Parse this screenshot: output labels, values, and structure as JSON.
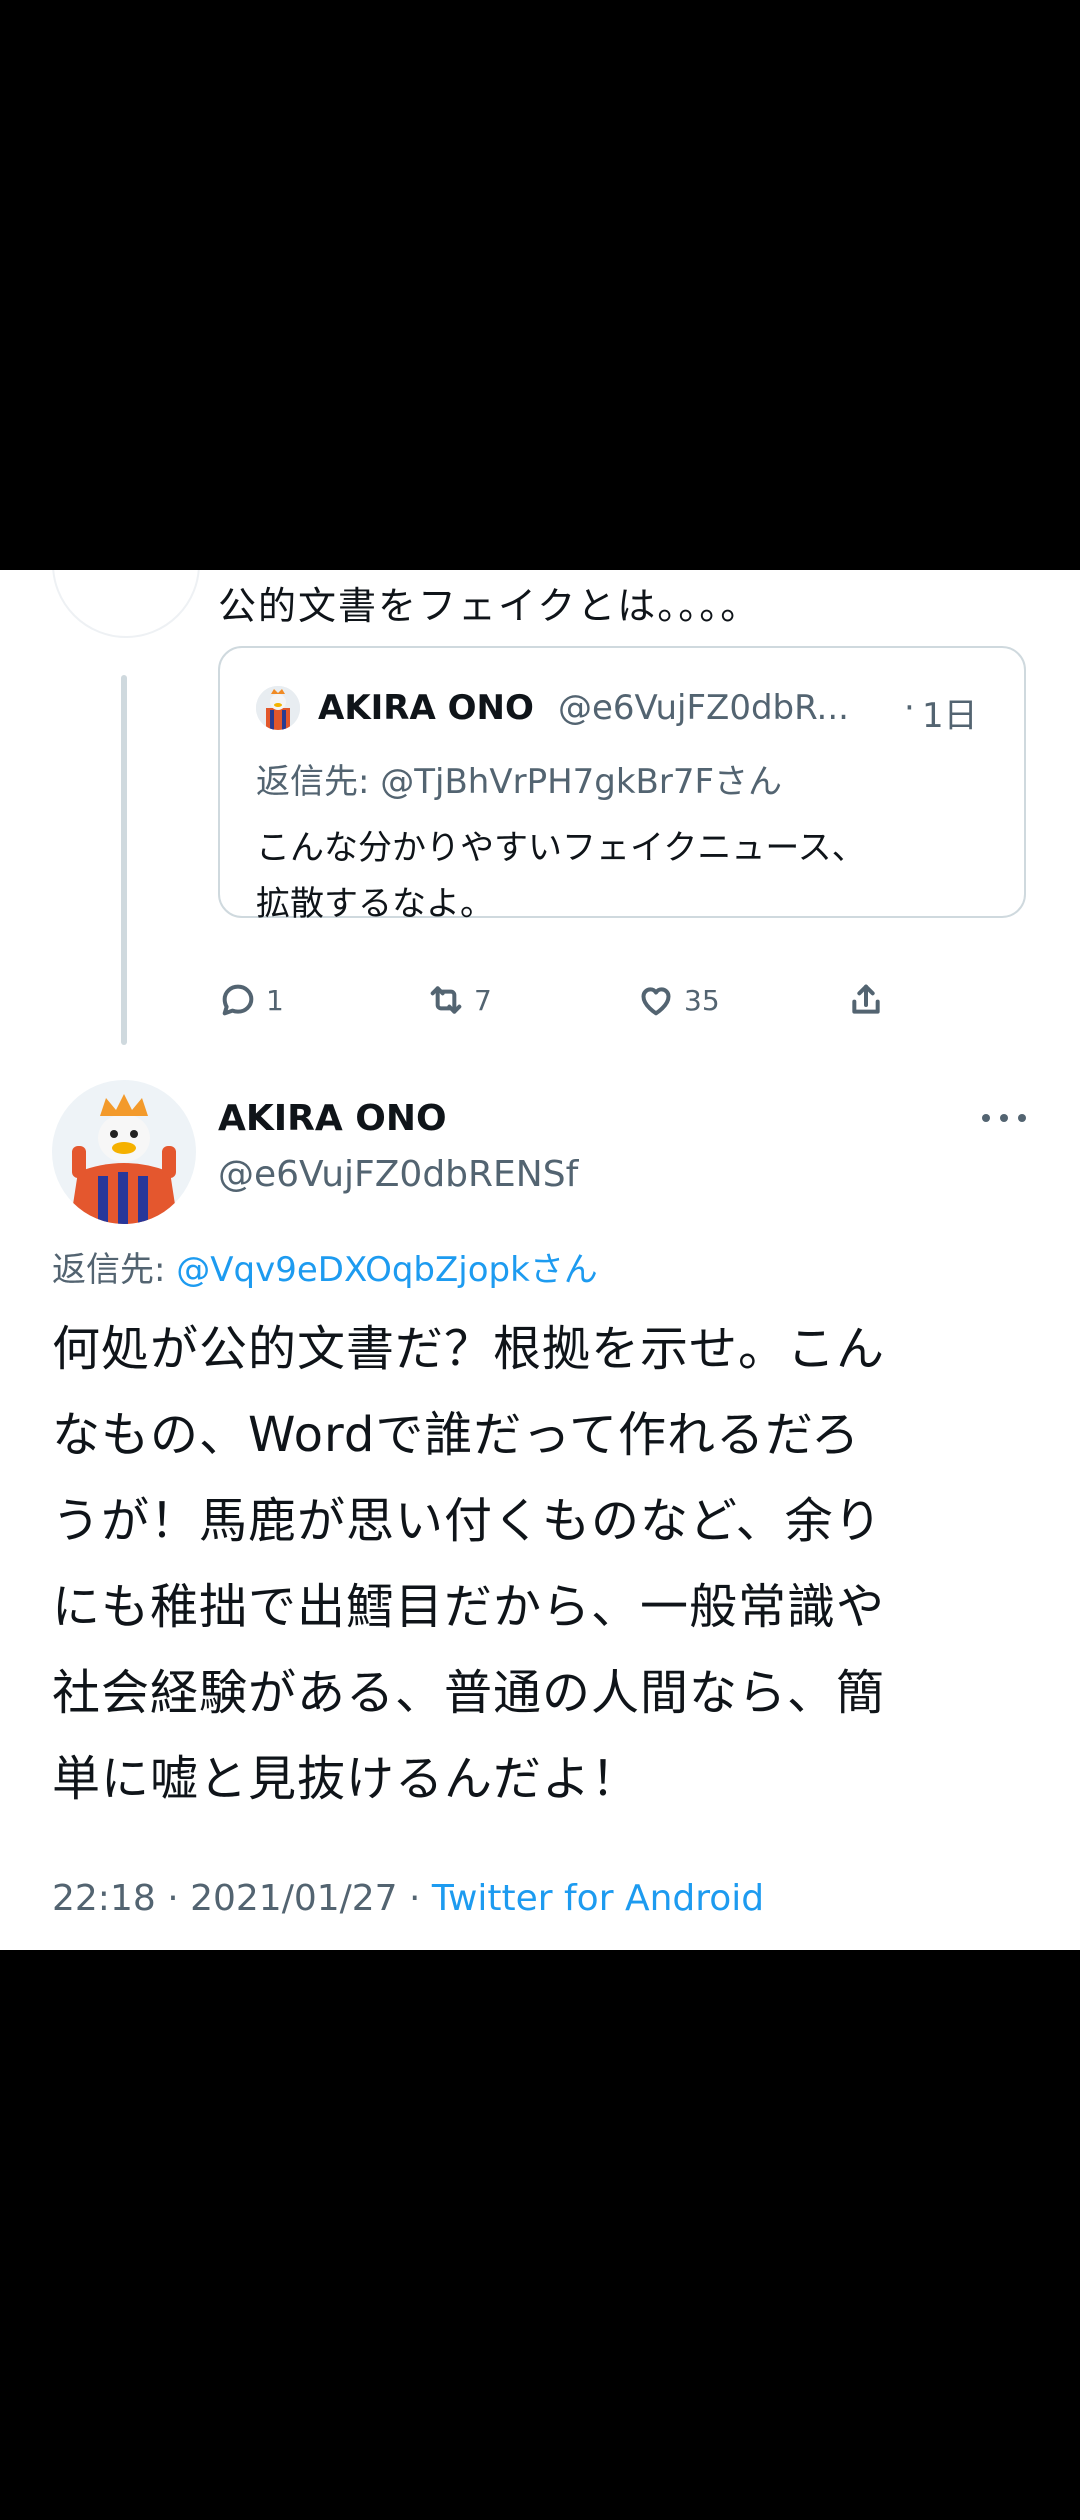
{
  "previous_tweet": {
    "text": "公的文書をフェイクとは。。。。",
    "quoted": {
      "name": "AKIRA ONO",
      "handle": "@e6VujFZ0dbR...",
      "separator": "·",
      "time": "1日",
      "reply_to": "返信先: @TjBhVrPH7gkBr7Fさん",
      "body_line1": "こんな分かりやすいフェイクニュース、",
      "body_line2": "拡散するなよ。"
    },
    "actions": {
      "replies": "1",
      "retweets": "7",
      "likes": "35"
    }
  },
  "main_tweet": {
    "name": "AKIRA ONO",
    "handle": "@e6VujFZ0dbRENSf",
    "reply_prefix": "返信先: ",
    "reply_handle": "@Vqv9eDXOqbZjopkさん",
    "body_lines": [
      "何処が公的文書だ？根拠を示せ。こん",
      "なもの、Wordで誰だって作れるだろ",
      "うが！馬鹿が思い付くものなど、余り",
      "にも稚拙で出鱈目だから、一般常識や",
      "社会経験がある、普通の人間なら、簡",
      "単に嘘と見抜けるんだよ！"
    ],
    "time_date": "22:18 · 2021/01/27 · ",
    "source": "Twitter for Android"
  },
  "colors": {
    "link": "#1d9bf0",
    "secondary_text": "#536471",
    "border": "#cfd9de"
  }
}
